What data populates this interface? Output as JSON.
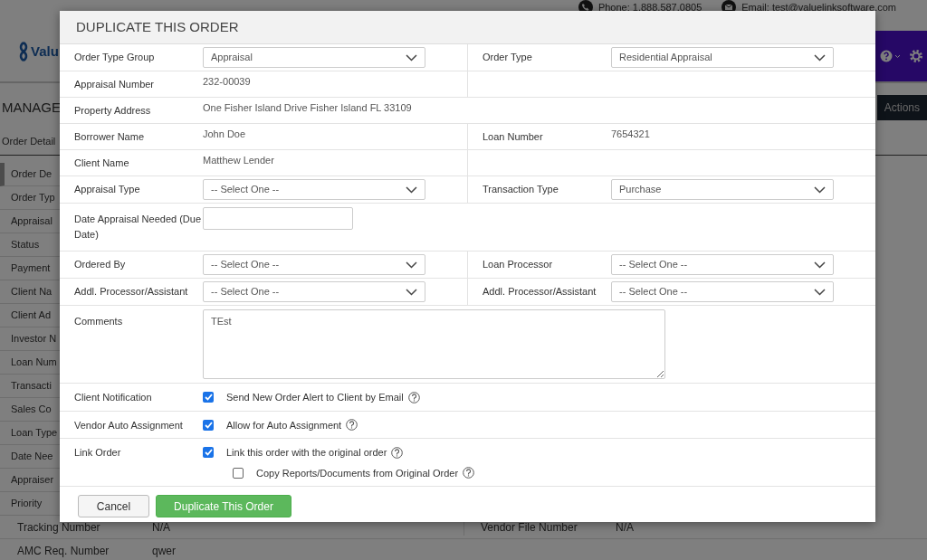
{
  "top_bar": {
    "phone": "Phone: 1.888.587.0805",
    "email": "Email: test@valuelinksoftware.com",
    "logo_text": "Valu"
  },
  "toolbar": {
    "page_title": "MANAGE",
    "actions": "Actions",
    "tab": "Order Detail"
  },
  "sidebar_rows": [
    {
      "label": "Order De",
      "selected": true
    },
    {
      "label": "Order Typ",
      "selected": false
    },
    {
      "label": "Appraisal",
      "selected": false
    },
    {
      "label": "Status",
      "selected": false
    },
    {
      "label": "Payment",
      "selected": false
    },
    {
      "label": "Client Na",
      "selected": false
    },
    {
      "label": "Client Ad",
      "selected": false
    },
    {
      "label": "Investor N",
      "selected": false
    },
    {
      "label": "Loan Num",
      "selected": false
    },
    {
      "label": "Transacti",
      "selected": false
    },
    {
      "label": "Sales Co",
      "selected": false
    },
    {
      "label": "Loan Type",
      "selected": false
    },
    {
      "label": "Date Nee",
      "selected": false
    },
    {
      "label": "Appraiser",
      "selected": false
    },
    {
      "label": "Priority",
      "selected": false
    }
  ],
  "detail_rows": [
    {
      "label": "Tracking Number",
      "value": "N/A",
      "label_2": "Vendor File Number",
      "value_2": "N/A"
    },
    {
      "label": "AMC Req. Number",
      "value": "qwer"
    }
  ],
  "modal": {
    "title": "DUPLICATE THIS ORDER",
    "rows": [
      {
        "kind": "pair",
        "fields": [
          {
            "label": "Order Type Group",
            "kind": "select",
            "value": "Appraisal"
          },
          {
            "label": "Order Type",
            "kind": "select",
            "value": "Residential Appraisal"
          }
        ]
      },
      {
        "kind": "pair",
        "fields": [
          {
            "label": "Appraisal Number",
            "kind": "text",
            "value": "232-00039"
          }
        ]
      },
      {
        "kind": "wide",
        "fields": [
          {
            "label": "Property Address",
            "kind": "text",
            "value": "One Fisher Island Drive Fisher Island FL 33109"
          }
        ]
      },
      {
        "kind": "pair",
        "fields": [
          {
            "label": "Borrower Name",
            "kind": "text",
            "value": "John Doe"
          },
          {
            "label": "Loan Number",
            "kind": "text",
            "value": "7654321"
          }
        ]
      },
      {
        "kind": "pair",
        "fields": [
          {
            "label": "Client Name",
            "kind": "text",
            "value": "Matthew Lender"
          }
        ]
      },
      {
        "kind": "pair",
        "fields": [
          {
            "label": "Appraisal Type",
            "kind": "select",
            "value": "-- Select One --"
          },
          {
            "label": "Transaction Type",
            "kind": "select",
            "value": "Purchase"
          }
        ]
      },
      {
        "kind": "wide",
        "fields": [
          {
            "label": "Date Appraisal Needed (Due Date)",
            "kind": "input"
          }
        ]
      },
      {
        "kind": "pair",
        "fields": [
          {
            "label": "Ordered By",
            "kind": "select",
            "value": "-- Select One --"
          },
          {
            "label": "Loan Processor",
            "kind": "select",
            "value": "-- Select One --"
          }
        ]
      },
      {
        "kind": "pair",
        "fields": [
          {
            "label": "Addl. Processor/Assistant",
            "kind": "select",
            "value": "-- Select One --"
          },
          {
            "label": "Addl. Processor/Assistant",
            "kind": "select",
            "value": "-- Select One --"
          }
        ]
      },
      {
        "kind": "wide",
        "fields": [
          {
            "label": "Comments",
            "kind": "textarea",
            "value": "TEst"
          }
        ]
      },
      {
        "kind": "check",
        "label": "Client Notification",
        "options": [
          {
            "text": "Send New Order Alert to Client by Email",
            "checked": true,
            "kind": "main"
          }
        ]
      },
      {
        "kind": "check",
        "label": "Vendor Auto Assignment",
        "options": [
          {
            "text": "Allow for Auto Assignment",
            "checked": true,
            "kind": "main"
          }
        ]
      },
      {
        "kind": "check",
        "label": "Link Order",
        "options": [
          {
            "text": "Link this order with the original order",
            "checked": true,
            "kind": "main"
          },
          {
            "text": "Copy Reports/Documents from Original Order",
            "checked": false,
            "kind": "sub"
          }
        ]
      }
    ],
    "buttons": [
      {
        "label": "Cancel",
        "kind": "secondary"
      },
      {
        "label": "Duplicate This Order",
        "kind": "primary"
      }
    ]
  }
}
